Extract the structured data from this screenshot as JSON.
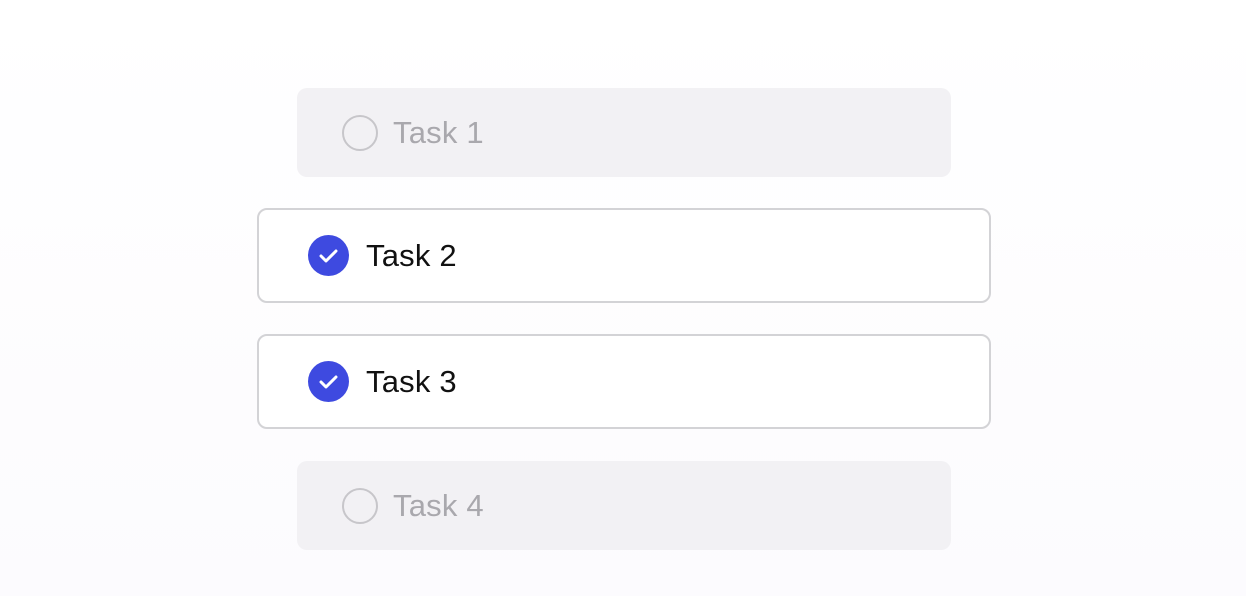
{
  "colors": {
    "accent": "#3e4ae0",
    "inactive_bg": "#f2f1f4",
    "inactive_text": "#a9a8ad",
    "active_border": "#d3d3d6",
    "active_text": "#111111"
  },
  "tasks": [
    {
      "label": "Task 1",
      "checked": false,
      "icon": "unchecked-circle-icon"
    },
    {
      "label": "Task 2",
      "checked": true,
      "icon": "check-circle-icon"
    },
    {
      "label": "Task 3",
      "checked": true,
      "icon": "check-circle-icon"
    },
    {
      "label": "Task 4",
      "checked": false,
      "icon": "unchecked-circle-icon"
    }
  ]
}
